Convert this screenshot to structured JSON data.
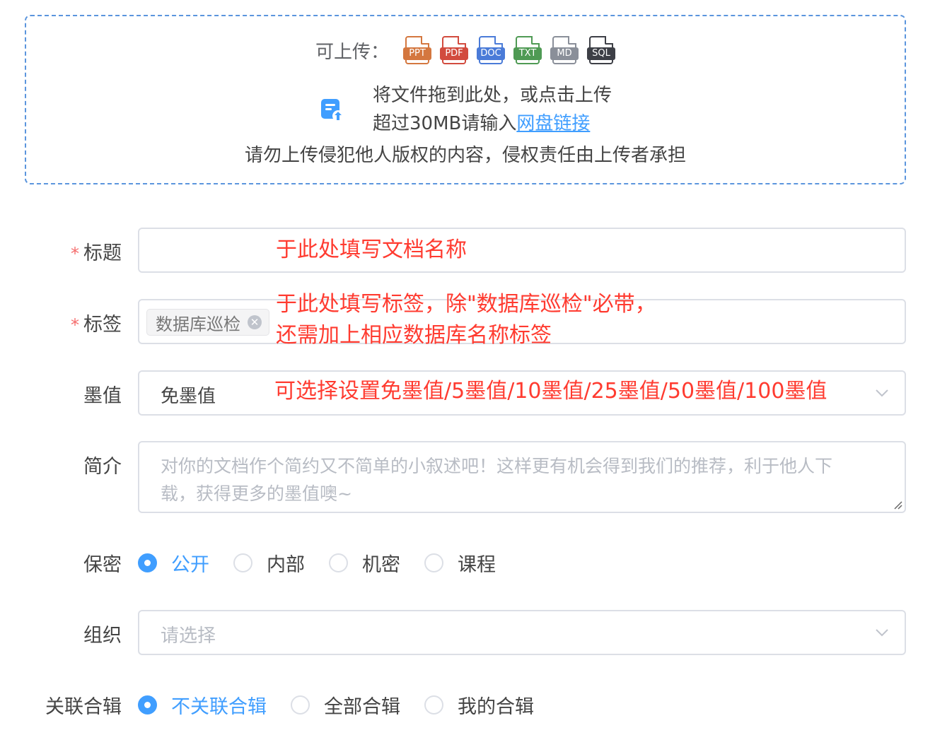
{
  "upload": {
    "types_label": "可上传：",
    "file_types": [
      {
        "label": "PPT",
        "color": "#d4773f"
      },
      {
        "label": "PDF",
        "color": "#d24b3e"
      },
      {
        "label": "DOC",
        "color": "#4a7bd8"
      },
      {
        "label": "TXT",
        "color": "#4f9a54"
      },
      {
        "label": "MD",
        "color": "#8a8f99"
      },
      {
        "label": "SQL",
        "color": "#3d3f46"
      }
    ],
    "drag_text": "将文件拖到此处，或点击上传",
    "size_text": "超过30MB请输入",
    "netdisk_link": "网盘链接",
    "copyright_notice": "请勿上传侵犯他人版权的内容，侵权责任由上传者承担",
    "upload_icon": "upload-doc-icon",
    "accent": "#409eff"
  },
  "form": {
    "title": {
      "required_mark": "*",
      "label": "标题",
      "value": "",
      "annotation": "于此处填写文档名称"
    },
    "tags": {
      "required_mark": "*",
      "label": "标签",
      "chips": [
        "数据库巡检"
      ],
      "chip_close_icon": "close-icon",
      "annotation_line1": "于此处填写标签，除\"数据库巡检\"必带，",
      "annotation_line2": "还需加上相应数据库名称标签"
    },
    "points": {
      "label": "墨值",
      "value": "免墨值",
      "annotation": "可选择设置免墨值/5墨值/10墨值/25墨值/50墨值/100墨值"
    },
    "summary": {
      "label": "简介",
      "placeholder": "对你的文档作个简约又不简单的小叙述吧！这样更有机会得到我们的推荐，利于他人下载，获得更多的墨值噢~"
    },
    "security": {
      "label": "保密",
      "options": [
        "公开",
        "内部",
        "机密",
        "课程"
      ],
      "selected": "公开"
    },
    "organization": {
      "label": "组织",
      "placeholder": "请选择"
    },
    "collection": {
      "label": "关联合辑",
      "options": [
        "不关联合辑",
        "全部合辑",
        "我的合辑"
      ],
      "selected": "不关联合辑"
    }
  },
  "colors": {
    "required": "#f56c6c",
    "annotation": "#ff3b30",
    "primary": "#409eff",
    "border": "#dcdfe6"
  }
}
